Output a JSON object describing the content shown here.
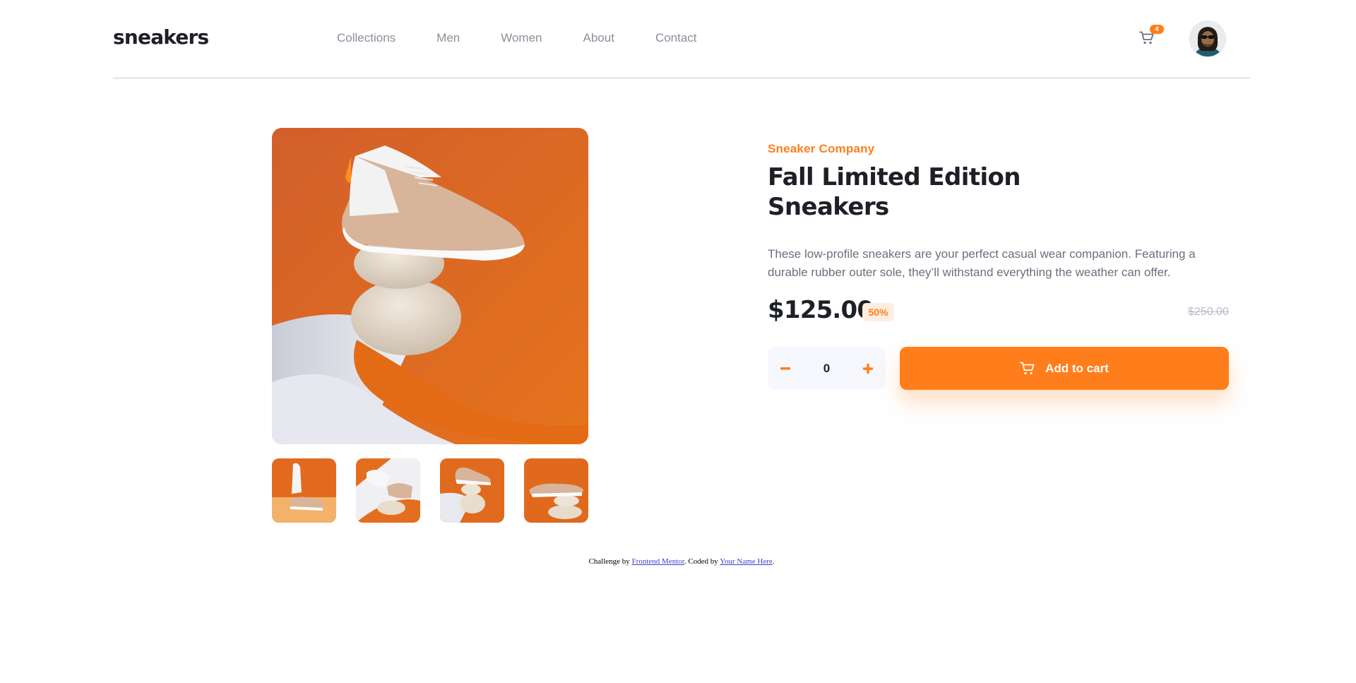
{
  "header": {
    "logo": "sneakers",
    "nav": [
      "Collections",
      "Men",
      "Women",
      "About",
      "Contact"
    ],
    "cart_icon": "cart-icon",
    "cart_count": "4",
    "avatar_icon": "avatar"
  },
  "gallery": {
    "main_image": "sneaker-on-stones-orange-background",
    "thumbnails": [
      "thumbnail-1",
      "thumbnail-2",
      "thumbnail-3",
      "thumbnail-4"
    ],
    "selected_index": 0
  },
  "product": {
    "company": "Sneaker Company",
    "title": "Fall Limited Edition Sneakers",
    "description": "These low-profile sneakers are your perfect casual wear companion. Featuring a durable rubber outer sole, they’ll withstand everything the weather can offer.",
    "price": "$125.00",
    "discount": "50%",
    "original_price": "$250.00",
    "quantity": "0",
    "add_to_cart_label": "Add to cart"
  },
  "footer": {
    "prefix": "Challenge by ",
    "link1": "Frontend Mentor",
    "middle": ". Coded by ",
    "link2": "Your Name Here",
    "suffix": "."
  },
  "colors": {
    "accent": "#ff7e1b",
    "accent_pale": "#ffede0",
    "text_dark": "#1d2026",
    "text_muted": "#68707d"
  }
}
